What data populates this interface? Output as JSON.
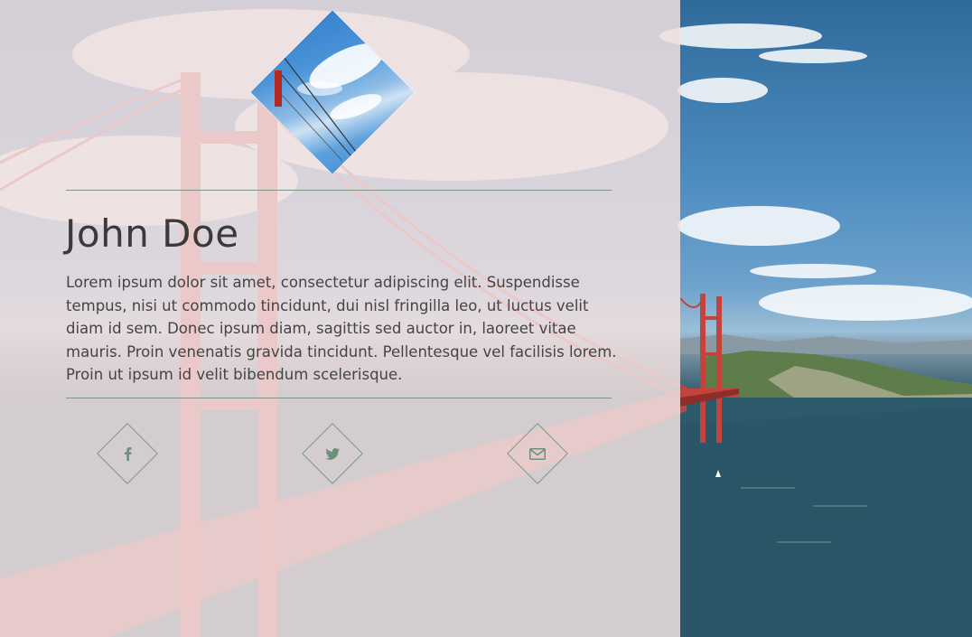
{
  "profile": {
    "name": "John Doe",
    "bio": "Lorem ipsum dolor sit amet, consectetur adipiscing elit. Suspendisse tempus, nisi ut commodo tincidunt, dui nisl fringilla leo, ut luctus velit diam id sem. Donec ipsum diam, sagittis sed auctor in, laoreet vitae mauris. Proin venenatis gravida tincidunt. Pellentesque vel facilisis lorem. Proin ut ipsum id velit bibendum scelerisque."
  },
  "social": [
    {
      "icon": "facebook-icon"
    },
    {
      "icon": "twitter-icon"
    },
    {
      "icon": "envelope-icon"
    }
  ],
  "colors": {
    "panel_overlay": "#f0e0e0",
    "accent": "#7a9a86",
    "divider": "#7f9588",
    "heading": "#3a3a3a",
    "body_text": "#444444",
    "bridge": "#c8433a"
  }
}
